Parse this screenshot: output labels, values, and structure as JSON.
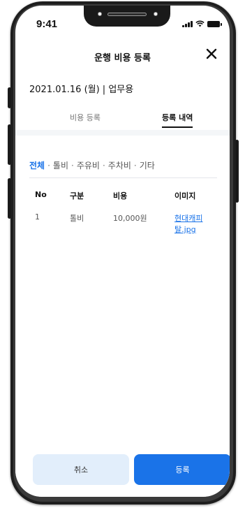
{
  "status": {
    "time": "9:41"
  },
  "header": {
    "title": "운행 비용 등록",
    "close_icon": "close-icon"
  },
  "date_line": "2021.01.16 (월) | 업무용",
  "tabs": [
    {
      "label": "비용 등록",
      "active": false
    },
    {
      "label": "등록 내역",
      "active": true
    }
  ],
  "filter": {
    "items": [
      "전체",
      "톨비",
      "주유비",
      "주차비",
      "기타"
    ],
    "separator": "·",
    "selected": "전체"
  },
  "table": {
    "headers": [
      "No",
      "구분",
      "비용",
      "이미지"
    ],
    "rows": [
      {
        "no": "1",
        "category": "톨비",
        "cost": "10,000원",
        "image": "현대캐피탈.jpg"
      }
    ]
  },
  "buttons": {
    "cancel": "취소",
    "submit": "등록"
  },
  "colors": {
    "accent": "#1a73e8",
    "cancel_bg": "#e2eefb",
    "text": "#111111"
  }
}
